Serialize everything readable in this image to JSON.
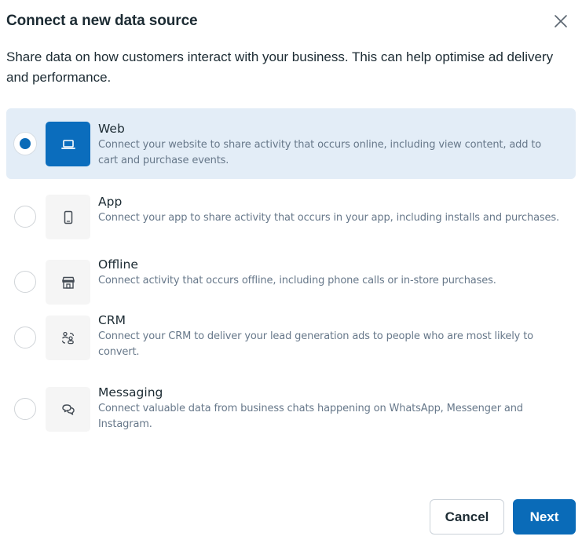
{
  "dialog": {
    "title": "Connect a new data source",
    "description": "Share data on how customers interact with your business. This can help optimise ad delivery and performance.",
    "close_icon": "close-icon"
  },
  "options": [
    {
      "id": "web",
      "title": "Web",
      "description": "Connect your website to share activity that occurs online, including view content, add to cart and purchase events.",
      "icon": "laptop-icon",
      "selected": true
    },
    {
      "id": "app",
      "title": "App",
      "description": "Connect your app to share activity that occurs in your app, including installs and purchases.",
      "icon": "mobile-phone-icon",
      "selected": false
    },
    {
      "id": "offline",
      "title": "Offline",
      "description": "Connect activity that occurs offline, including phone calls or in-store purchases.",
      "icon": "storefront-icon",
      "selected": false
    },
    {
      "id": "crm",
      "title": "CRM",
      "description": "Connect your CRM to deliver your lead generation ads to people who are most likely to convert.",
      "icon": "people-sync-icon",
      "selected": false
    },
    {
      "id": "messaging",
      "title": "Messaging",
      "description": "Connect valuable data from business chats happening on WhatsApp, Messenger and Instagram.",
      "icon": "chat-bubbles-icon",
      "selected": false
    }
  ],
  "footer": {
    "cancel_label": "Cancel",
    "next_label": "Next"
  },
  "colors": {
    "primary": "#0a6bb8",
    "selected_background": "#e3edf7",
    "text": "#1c2b33",
    "secondary_text": "#67788a"
  }
}
